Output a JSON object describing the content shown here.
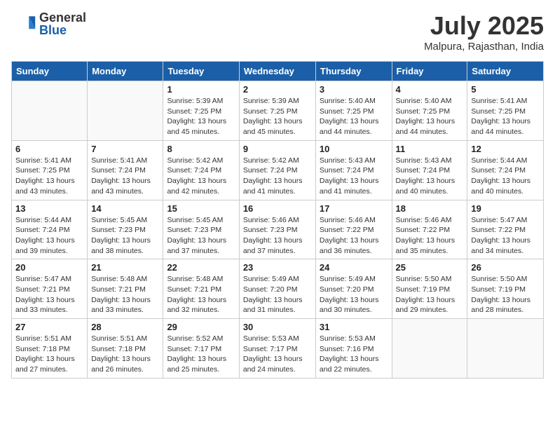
{
  "header": {
    "logo_general": "General",
    "logo_blue": "Blue",
    "month_title": "July 2025",
    "location": "Malpura, Rajasthan, India"
  },
  "days_of_week": [
    "Sunday",
    "Monday",
    "Tuesday",
    "Wednesday",
    "Thursday",
    "Friday",
    "Saturday"
  ],
  "weeks": [
    [
      {
        "day": "",
        "sunrise": "",
        "sunset": "",
        "daylight": ""
      },
      {
        "day": "",
        "sunrise": "",
        "sunset": "",
        "daylight": ""
      },
      {
        "day": "1",
        "sunrise": "Sunrise: 5:39 AM",
        "sunset": "Sunset: 7:25 PM",
        "daylight": "Daylight: 13 hours and 45 minutes."
      },
      {
        "day": "2",
        "sunrise": "Sunrise: 5:39 AM",
        "sunset": "Sunset: 7:25 PM",
        "daylight": "Daylight: 13 hours and 45 minutes."
      },
      {
        "day": "3",
        "sunrise": "Sunrise: 5:40 AM",
        "sunset": "Sunset: 7:25 PM",
        "daylight": "Daylight: 13 hours and 44 minutes."
      },
      {
        "day": "4",
        "sunrise": "Sunrise: 5:40 AM",
        "sunset": "Sunset: 7:25 PM",
        "daylight": "Daylight: 13 hours and 44 minutes."
      },
      {
        "day": "5",
        "sunrise": "Sunrise: 5:41 AM",
        "sunset": "Sunset: 7:25 PM",
        "daylight": "Daylight: 13 hours and 44 minutes."
      }
    ],
    [
      {
        "day": "6",
        "sunrise": "Sunrise: 5:41 AM",
        "sunset": "Sunset: 7:25 PM",
        "daylight": "Daylight: 13 hours and 43 minutes."
      },
      {
        "day": "7",
        "sunrise": "Sunrise: 5:41 AM",
        "sunset": "Sunset: 7:24 PM",
        "daylight": "Daylight: 13 hours and 43 minutes."
      },
      {
        "day": "8",
        "sunrise": "Sunrise: 5:42 AM",
        "sunset": "Sunset: 7:24 PM",
        "daylight": "Daylight: 13 hours and 42 minutes."
      },
      {
        "day": "9",
        "sunrise": "Sunrise: 5:42 AM",
        "sunset": "Sunset: 7:24 PM",
        "daylight": "Daylight: 13 hours and 41 minutes."
      },
      {
        "day": "10",
        "sunrise": "Sunrise: 5:43 AM",
        "sunset": "Sunset: 7:24 PM",
        "daylight": "Daylight: 13 hours and 41 minutes."
      },
      {
        "day": "11",
        "sunrise": "Sunrise: 5:43 AM",
        "sunset": "Sunset: 7:24 PM",
        "daylight": "Daylight: 13 hours and 40 minutes."
      },
      {
        "day": "12",
        "sunrise": "Sunrise: 5:44 AM",
        "sunset": "Sunset: 7:24 PM",
        "daylight": "Daylight: 13 hours and 40 minutes."
      }
    ],
    [
      {
        "day": "13",
        "sunrise": "Sunrise: 5:44 AM",
        "sunset": "Sunset: 7:24 PM",
        "daylight": "Daylight: 13 hours and 39 minutes."
      },
      {
        "day": "14",
        "sunrise": "Sunrise: 5:45 AM",
        "sunset": "Sunset: 7:23 PM",
        "daylight": "Daylight: 13 hours and 38 minutes."
      },
      {
        "day": "15",
        "sunrise": "Sunrise: 5:45 AM",
        "sunset": "Sunset: 7:23 PM",
        "daylight": "Daylight: 13 hours and 37 minutes."
      },
      {
        "day": "16",
        "sunrise": "Sunrise: 5:46 AM",
        "sunset": "Sunset: 7:23 PM",
        "daylight": "Daylight: 13 hours and 37 minutes."
      },
      {
        "day": "17",
        "sunrise": "Sunrise: 5:46 AM",
        "sunset": "Sunset: 7:22 PM",
        "daylight": "Daylight: 13 hours and 36 minutes."
      },
      {
        "day": "18",
        "sunrise": "Sunrise: 5:46 AM",
        "sunset": "Sunset: 7:22 PM",
        "daylight": "Daylight: 13 hours and 35 minutes."
      },
      {
        "day": "19",
        "sunrise": "Sunrise: 5:47 AM",
        "sunset": "Sunset: 7:22 PM",
        "daylight": "Daylight: 13 hours and 34 minutes."
      }
    ],
    [
      {
        "day": "20",
        "sunrise": "Sunrise: 5:47 AM",
        "sunset": "Sunset: 7:21 PM",
        "daylight": "Daylight: 13 hours and 33 minutes."
      },
      {
        "day": "21",
        "sunrise": "Sunrise: 5:48 AM",
        "sunset": "Sunset: 7:21 PM",
        "daylight": "Daylight: 13 hours and 33 minutes."
      },
      {
        "day": "22",
        "sunrise": "Sunrise: 5:48 AM",
        "sunset": "Sunset: 7:21 PM",
        "daylight": "Daylight: 13 hours and 32 minutes."
      },
      {
        "day": "23",
        "sunrise": "Sunrise: 5:49 AM",
        "sunset": "Sunset: 7:20 PM",
        "daylight": "Daylight: 13 hours and 31 minutes."
      },
      {
        "day": "24",
        "sunrise": "Sunrise: 5:49 AM",
        "sunset": "Sunset: 7:20 PM",
        "daylight": "Daylight: 13 hours and 30 minutes."
      },
      {
        "day": "25",
        "sunrise": "Sunrise: 5:50 AM",
        "sunset": "Sunset: 7:19 PM",
        "daylight": "Daylight: 13 hours and 29 minutes."
      },
      {
        "day": "26",
        "sunrise": "Sunrise: 5:50 AM",
        "sunset": "Sunset: 7:19 PM",
        "daylight": "Daylight: 13 hours and 28 minutes."
      }
    ],
    [
      {
        "day": "27",
        "sunrise": "Sunrise: 5:51 AM",
        "sunset": "Sunset: 7:18 PM",
        "daylight": "Daylight: 13 hours and 27 minutes."
      },
      {
        "day": "28",
        "sunrise": "Sunrise: 5:51 AM",
        "sunset": "Sunset: 7:18 PM",
        "daylight": "Daylight: 13 hours and 26 minutes."
      },
      {
        "day": "29",
        "sunrise": "Sunrise: 5:52 AM",
        "sunset": "Sunset: 7:17 PM",
        "daylight": "Daylight: 13 hours and 25 minutes."
      },
      {
        "day": "30",
        "sunrise": "Sunrise: 5:53 AM",
        "sunset": "Sunset: 7:17 PM",
        "daylight": "Daylight: 13 hours and 24 minutes."
      },
      {
        "day": "31",
        "sunrise": "Sunrise: 5:53 AM",
        "sunset": "Sunset: 7:16 PM",
        "daylight": "Daylight: 13 hours and 22 minutes."
      },
      {
        "day": "",
        "sunrise": "",
        "sunset": "",
        "daylight": ""
      },
      {
        "day": "",
        "sunrise": "",
        "sunset": "",
        "daylight": ""
      }
    ]
  ]
}
